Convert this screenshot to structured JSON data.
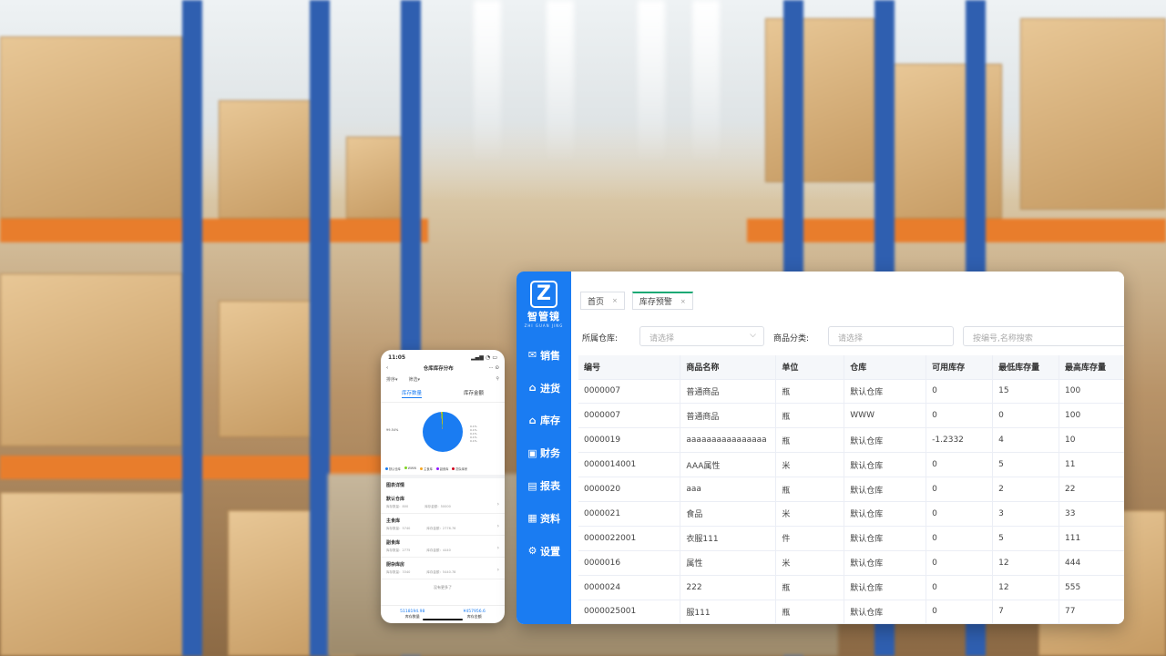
{
  "phone": {
    "status_time": "11:05",
    "title": "仓库库存分布",
    "filter_a": "排序",
    "filter_b": "筛选",
    "tab_qty": "库存数量",
    "tab_amount": "库存金额",
    "pie_label": "99.54%",
    "pie_side_labels": [
      "0.1%",
      "0.1%",
      "0.1%",
      "0.1%",
      "0.1%"
    ],
    "legend": [
      {
        "label": "默认仓库",
        "color": "#1a7cf2"
      },
      {
        "label": "WWW",
        "color": "#7ed321"
      },
      {
        "label": "主食库",
        "color": "#f5a623"
      },
      {
        "label": "副食库",
        "color": "#9013fe"
      },
      {
        "label": "厨杂库房",
        "color": "#d0021b"
      }
    ],
    "section_title": "图表详情",
    "rows": [
      {
        "name": "默认仓库",
        "qty": "库存数量：800",
        "amount": "库存金额：50000"
      },
      {
        "name": "主食库",
        "qty": "库存数量：5740",
        "amount": "库存金额：2776.76"
      },
      {
        "name": "副食库",
        "qty": "库存数量：2775",
        "amount": "库存金额：4440"
      },
      {
        "name": "厨杂库房",
        "qty": "库存数量：3340",
        "amount": "库存金额：5440.78"
      }
    ],
    "no_more": "没有更多了",
    "footer_qty_value": "5118194.98",
    "footer_qty_label": "库存数量",
    "footer_amount_value": "¥457956.6",
    "footer_amount_label": "库存金额"
  },
  "app": {
    "logo_mark": "Z",
    "logo_name": "智管镜",
    "logo_sub": "ZHI GUAN JING",
    "menu": [
      {
        "label": "销售",
        "icon": "mail-icon"
      },
      {
        "label": "进货",
        "icon": "home-icon"
      },
      {
        "label": "库存",
        "icon": "warehouse-icon"
      },
      {
        "label": "财务",
        "icon": "finance-icon"
      },
      {
        "label": "报表",
        "icon": "report-icon"
      },
      {
        "label": "资料",
        "icon": "data-icon"
      },
      {
        "label": "设置",
        "icon": "gear-icon"
      }
    ],
    "tabs": [
      {
        "label": "首页",
        "close": "×"
      },
      {
        "label": "库存预警",
        "close": "×"
      }
    ],
    "filters": {
      "warehouse_label": "所属仓库:",
      "warehouse_placeholder": "请选择",
      "category_label": "商品分类:",
      "category_placeholder": "请选择",
      "search_placeholder": "按编号,名称搜索"
    },
    "columns": [
      "编号",
      "商品名称",
      "单位",
      "仓库",
      "可用库存",
      "最低库存量",
      "最高库存量"
    ],
    "rows": [
      [
        "0000007",
        "普通商品",
        "瓶",
        "默认仓库",
        "0",
        "15",
        "100"
      ],
      [
        "0000007",
        "普通商品",
        "瓶",
        "WWW",
        "0",
        "0",
        "100"
      ],
      [
        "0000019",
        "aaaaaaaaaaaaaaaa",
        "瓶",
        "默认仓库",
        "-1.2332",
        "4",
        "10"
      ],
      [
        "0000014001",
        "AAA属性",
        "米",
        "默认仓库",
        "0",
        "5",
        "11"
      ],
      [
        "0000020",
        "aaa",
        "瓶",
        "默认仓库",
        "0",
        "2",
        "22"
      ],
      [
        "0000021",
        "食品",
        "米",
        "默认仓库",
        "0",
        "3",
        "33"
      ],
      [
        "0000022001",
        "衣服111",
        "件",
        "默认仓库",
        "0",
        "5",
        "111"
      ],
      [
        "0000016",
        "属性",
        "米",
        "默认仓库",
        "0",
        "12",
        "444"
      ],
      [
        "0000024",
        "222",
        "瓶",
        "默认仓库",
        "0",
        "12",
        "555"
      ],
      [
        "0000025001",
        "服111",
        "瓶",
        "默认仓库",
        "0",
        "7",
        "77"
      ]
    ]
  }
}
